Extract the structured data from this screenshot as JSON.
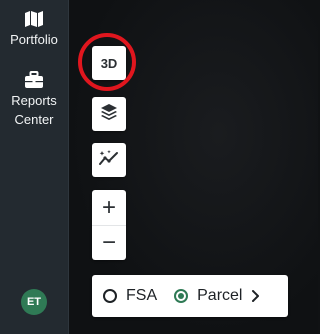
{
  "sidebar": {
    "items": [
      {
        "label": "Portfolio",
        "icon": "map-icon"
      },
      {
        "label": "Reports\nCenter",
        "icon": "briefcase-icon"
      }
    ],
    "avatar_initials": "ET"
  },
  "map_controls": {
    "view_3d_label": "3D",
    "layers_icon": "layers-icon",
    "trend_icon": "sparkle-trend-icon",
    "zoom_in_label": "+",
    "zoom_out_label": "−"
  },
  "layer_toggle": {
    "options": [
      {
        "label": "FSA",
        "selected": false
      },
      {
        "label": "Parcel",
        "selected": true
      }
    ],
    "chevron_icon": "chevron-right-icon"
  },
  "colors": {
    "sidebar_bg": "#232a30",
    "map_bg": "#101214",
    "accent_green": "#2f7a55",
    "highlight_red": "#e0161e"
  }
}
